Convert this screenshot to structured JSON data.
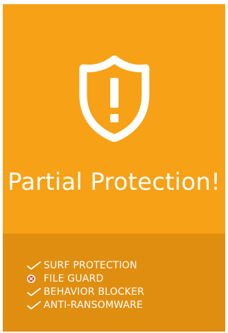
{
  "status": {
    "title": "Partial Protection!",
    "state": "warning",
    "icon": "shield-exclamation-icon"
  },
  "features": [
    {
      "label": "SURF PROTECTION",
      "state": "enabled",
      "icon": "checkmark-icon"
    },
    {
      "label": "FILE GUARD",
      "state": "disabled",
      "icon": "error-x-icon"
    },
    {
      "label": "BEHAVIOR BLOCKER",
      "state": "enabled",
      "icon": "checkmark-icon"
    },
    {
      "label": "ANTI-RANSOMWARE",
      "state": "enabled",
      "icon": "checkmark-icon"
    }
  ],
  "colors": {
    "card_background": "#f7a116",
    "footer_background": "#e08e10",
    "text": "#ffffff",
    "error_icon": "#d9322b"
  }
}
